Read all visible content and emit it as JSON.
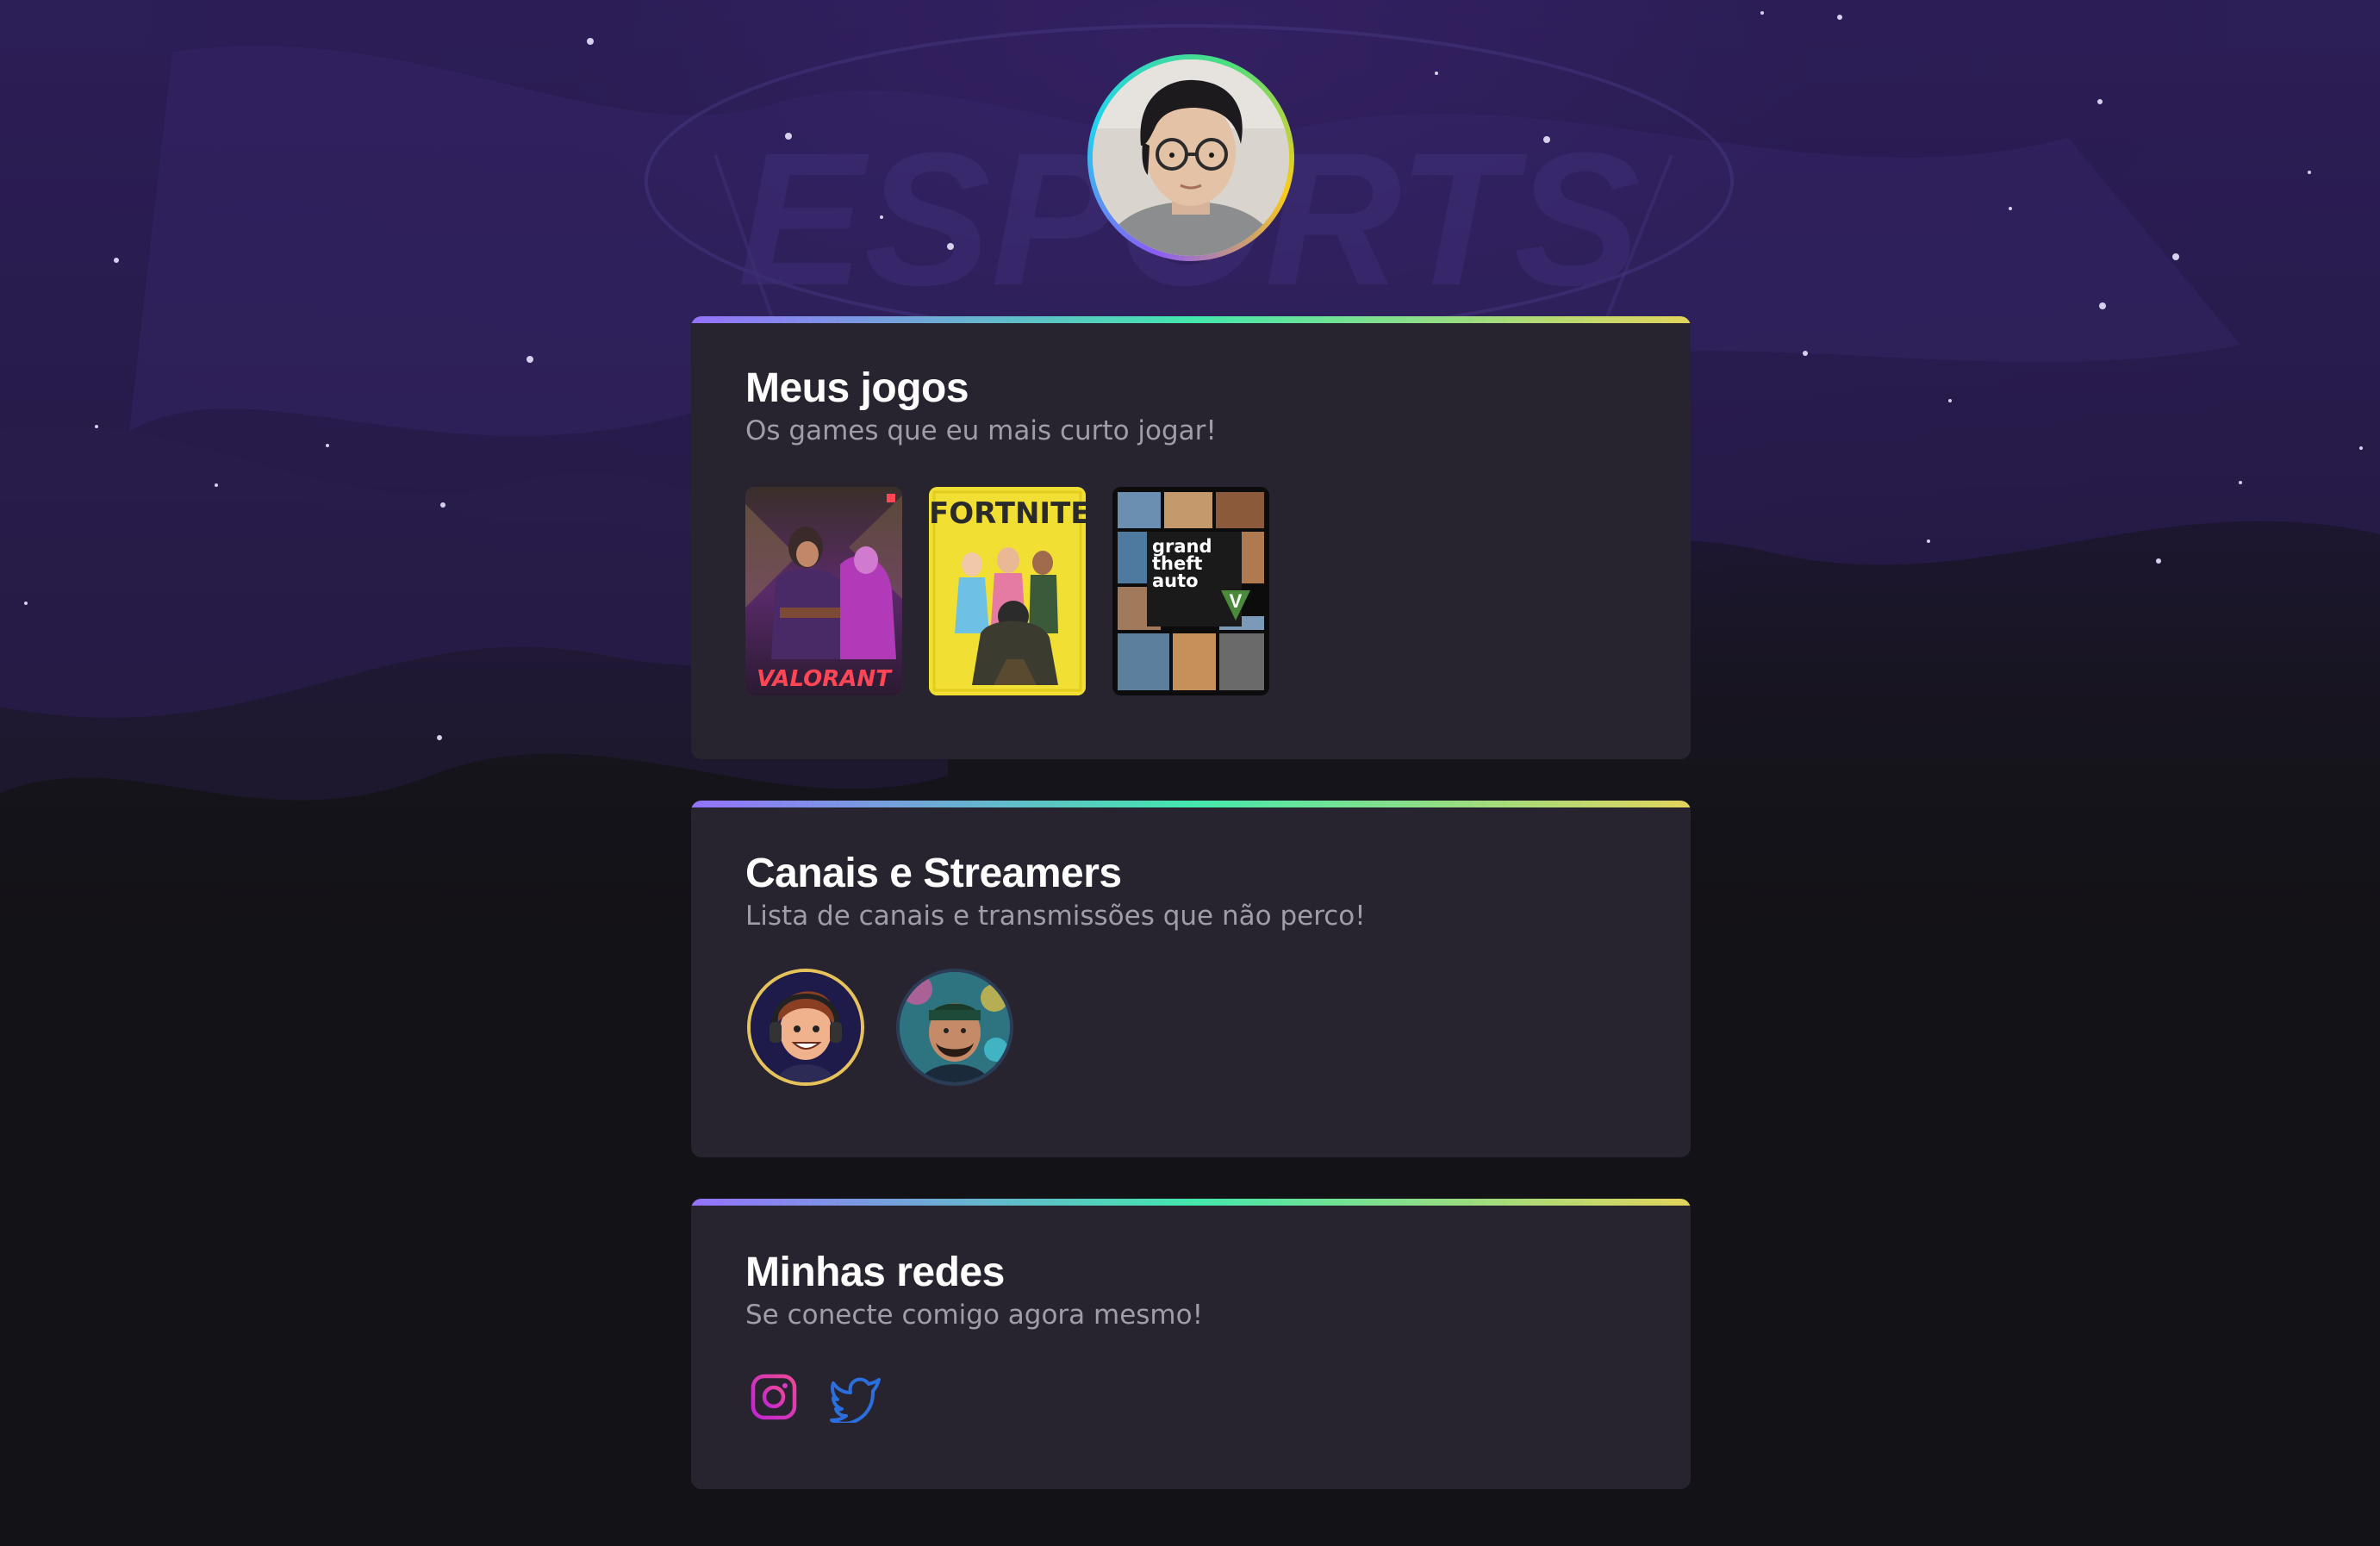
{
  "profile": {
    "avatar_alt": "Foto de perfil"
  },
  "sections": {
    "games": {
      "title": "Meus jogos",
      "subtitle": "Os games que eu mais curto jogar!",
      "items": [
        {
          "name": "VALORANT",
          "icon": "valorant-cover"
        },
        {
          "name": "FORTNITE",
          "icon": "fortnite-cover"
        },
        {
          "name": "grand theft auto",
          "icon": "gta-v-cover"
        }
      ]
    },
    "streamers": {
      "title": "Canais e Streamers",
      "subtitle": "Lista de canais e transmissões que não perco!",
      "items": [
        {
          "icon": "streamer-avatar-1"
        },
        {
          "icon": "streamer-avatar-2"
        }
      ]
    },
    "socials": {
      "title": "Minhas redes",
      "subtitle": "Se conecte comigo agora mesmo!",
      "items": [
        {
          "icon": "instagram-icon",
          "color": "#e11eb4"
        },
        {
          "icon": "twitter-icon",
          "color": "#1d6fe0"
        }
      ]
    }
  },
  "colors": {
    "card_bg": "#28242f",
    "page_bg": "#131216",
    "accent_gradient": [
      "#9572fc",
      "#43e7ad",
      "#e2d45c"
    ],
    "title": "#ffffff",
    "subtitle": "#a09ca8"
  }
}
